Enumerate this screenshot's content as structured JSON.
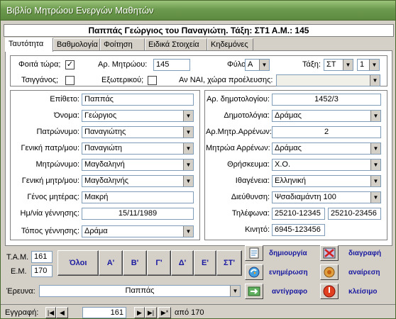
{
  "window": {
    "title": "Βιβλίο Μητρώου Ενεργών Μαθητών"
  },
  "header": {
    "text": "Παππάς Γεώργιος του Παναγιώτη. Τάξη: ΣΤ1  Α.Μ.: 145"
  },
  "tabs": [
    "Ταυτότητα",
    "Βαθμολογία",
    "Φοίτηση",
    "Ειδικά Στοιχεία",
    "Κηδεμόνες"
  ],
  "top": {
    "attending_label": "Φοιτά τώρα;",
    "attending_checked": "✓",
    "regno_label": "Αρ. Μητρώου:",
    "regno": "145",
    "gender_label": "Φύλο:",
    "gender": "Α",
    "class_label": "Τάξη:",
    "class_grade": "ΣΤ",
    "class_section": "1",
    "gypsy_label": "Τσιγγάνος;",
    "foreign_label": "Εξωτερικού;",
    "origin_label": "Αν ΝΑΙ, χώρα προέλευσης:"
  },
  "left": {
    "surname_label": "Επίθετο:",
    "surname": "Παππάς",
    "name_label": "Όνομα:",
    "name": "Γεώργιος",
    "father_label": "Πατρώνυμο:",
    "father": "Παναγιώτης",
    "father_gen_label": "Γενική πατρ/μου:",
    "father_gen": "Παναγιώτη",
    "mother_label": "Μητρώνυμο:",
    "mother": "Μαγδαληνή",
    "mother_gen_label": "Γενική μητρ/μου:",
    "mother_gen": "Μαγδαληνής",
    "mother_family_label": "Γένος μητέρας:",
    "mother_family": "Μακρή",
    "birthdate_label": "Ημ/νία γέννησης:",
    "birthdate": "15/11/1989",
    "birthplace_label": "Τόπος γέννησης:",
    "birthplace": "Δράμα"
  },
  "right": {
    "municipal_no_label": "Αρ. δημοτολογίου:",
    "municipal_no": "1452/3",
    "municipality_label": "Δημοτολόγια:",
    "municipality": "Δράμας",
    "male_reg_no_label": "Αρ.Μητρ.Αρρένων:",
    "male_reg_no": "2",
    "male_reg_label": "Μητρώα Αρρένων:",
    "male_reg": "Δράμας",
    "religion_label": "Θρήσκευμα:",
    "religion": "Χ.Ο.",
    "nationality_label": "Ιθαγένεια:",
    "nationality": "Ελληνική",
    "address_label": "Διεύθυνση:",
    "address": "Ψσαδιαμάντη 100",
    "phones_label": "Τηλέφωνα:",
    "phone1": "25210-12345",
    "phone2": "25210-23456",
    "mobile_label": "Κινητό:",
    "mobile": "6945-123456"
  },
  "bottom": {
    "tam_label": "Τ.Α.Μ.",
    "tam": "161",
    "em_label": "Ε.Μ.",
    "em": "170",
    "class_buttons": [
      "Όλοι",
      "Α'",
      "Β'",
      "Γ'",
      "Δ'",
      "Ε'",
      "ΣΤ'"
    ],
    "actions": {
      "create": "δημιουργία",
      "delete": "διαγραφή",
      "update": "ενημέρωση",
      "undo": "αναίρεση",
      "copy": "αντίγραφο",
      "close": "κλείσιμο"
    },
    "search_label": "Έρευνα:",
    "search_value": "Παππάς"
  },
  "nav": {
    "record_label": "Εγγραφή:",
    "current": "161",
    "of_label": "από 170"
  }
}
